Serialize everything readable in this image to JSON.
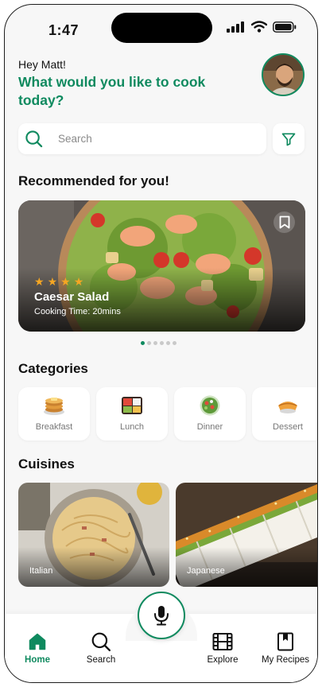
{
  "status_bar": {
    "time": "1:47"
  },
  "greeting": {
    "hello": "Hey Matt!",
    "question": "What would you like to cook today?"
  },
  "search": {
    "placeholder": "Search"
  },
  "recommended": {
    "title": "Recommended for you!",
    "card": {
      "name": "Caesar Salad",
      "cooking_time": "Cooking Time: 20mins",
      "rating_stars": 4,
      "page_index": 1,
      "page_count": 6
    }
  },
  "categories": {
    "title": "Categories",
    "items": [
      {
        "label": "Breakfast",
        "icon": "pancakes-icon"
      },
      {
        "label": "Lunch",
        "icon": "bento-box-icon"
      },
      {
        "label": "Dinner",
        "icon": "salad-bowl-icon"
      },
      {
        "label": "Dessert",
        "icon": "pie-icon"
      }
    ]
  },
  "cuisines": {
    "title": "Cuisines",
    "items": [
      {
        "label": "Italian"
      },
      {
        "label": "Japanese"
      }
    ]
  },
  "nav": {
    "items": [
      {
        "label": "Home",
        "icon": "home-icon",
        "active": true
      },
      {
        "label": "Search",
        "icon": "search-icon"
      },
      {
        "label": "Explore",
        "icon": "film-icon"
      },
      {
        "label": "My Recipes",
        "icon": "bookmark-book-icon"
      }
    ],
    "center_button": "microphone-icon"
  },
  "colors": {
    "accent": "#0f8a5f",
    "star": "#f5a623",
    "background": "#f7f7f7"
  }
}
